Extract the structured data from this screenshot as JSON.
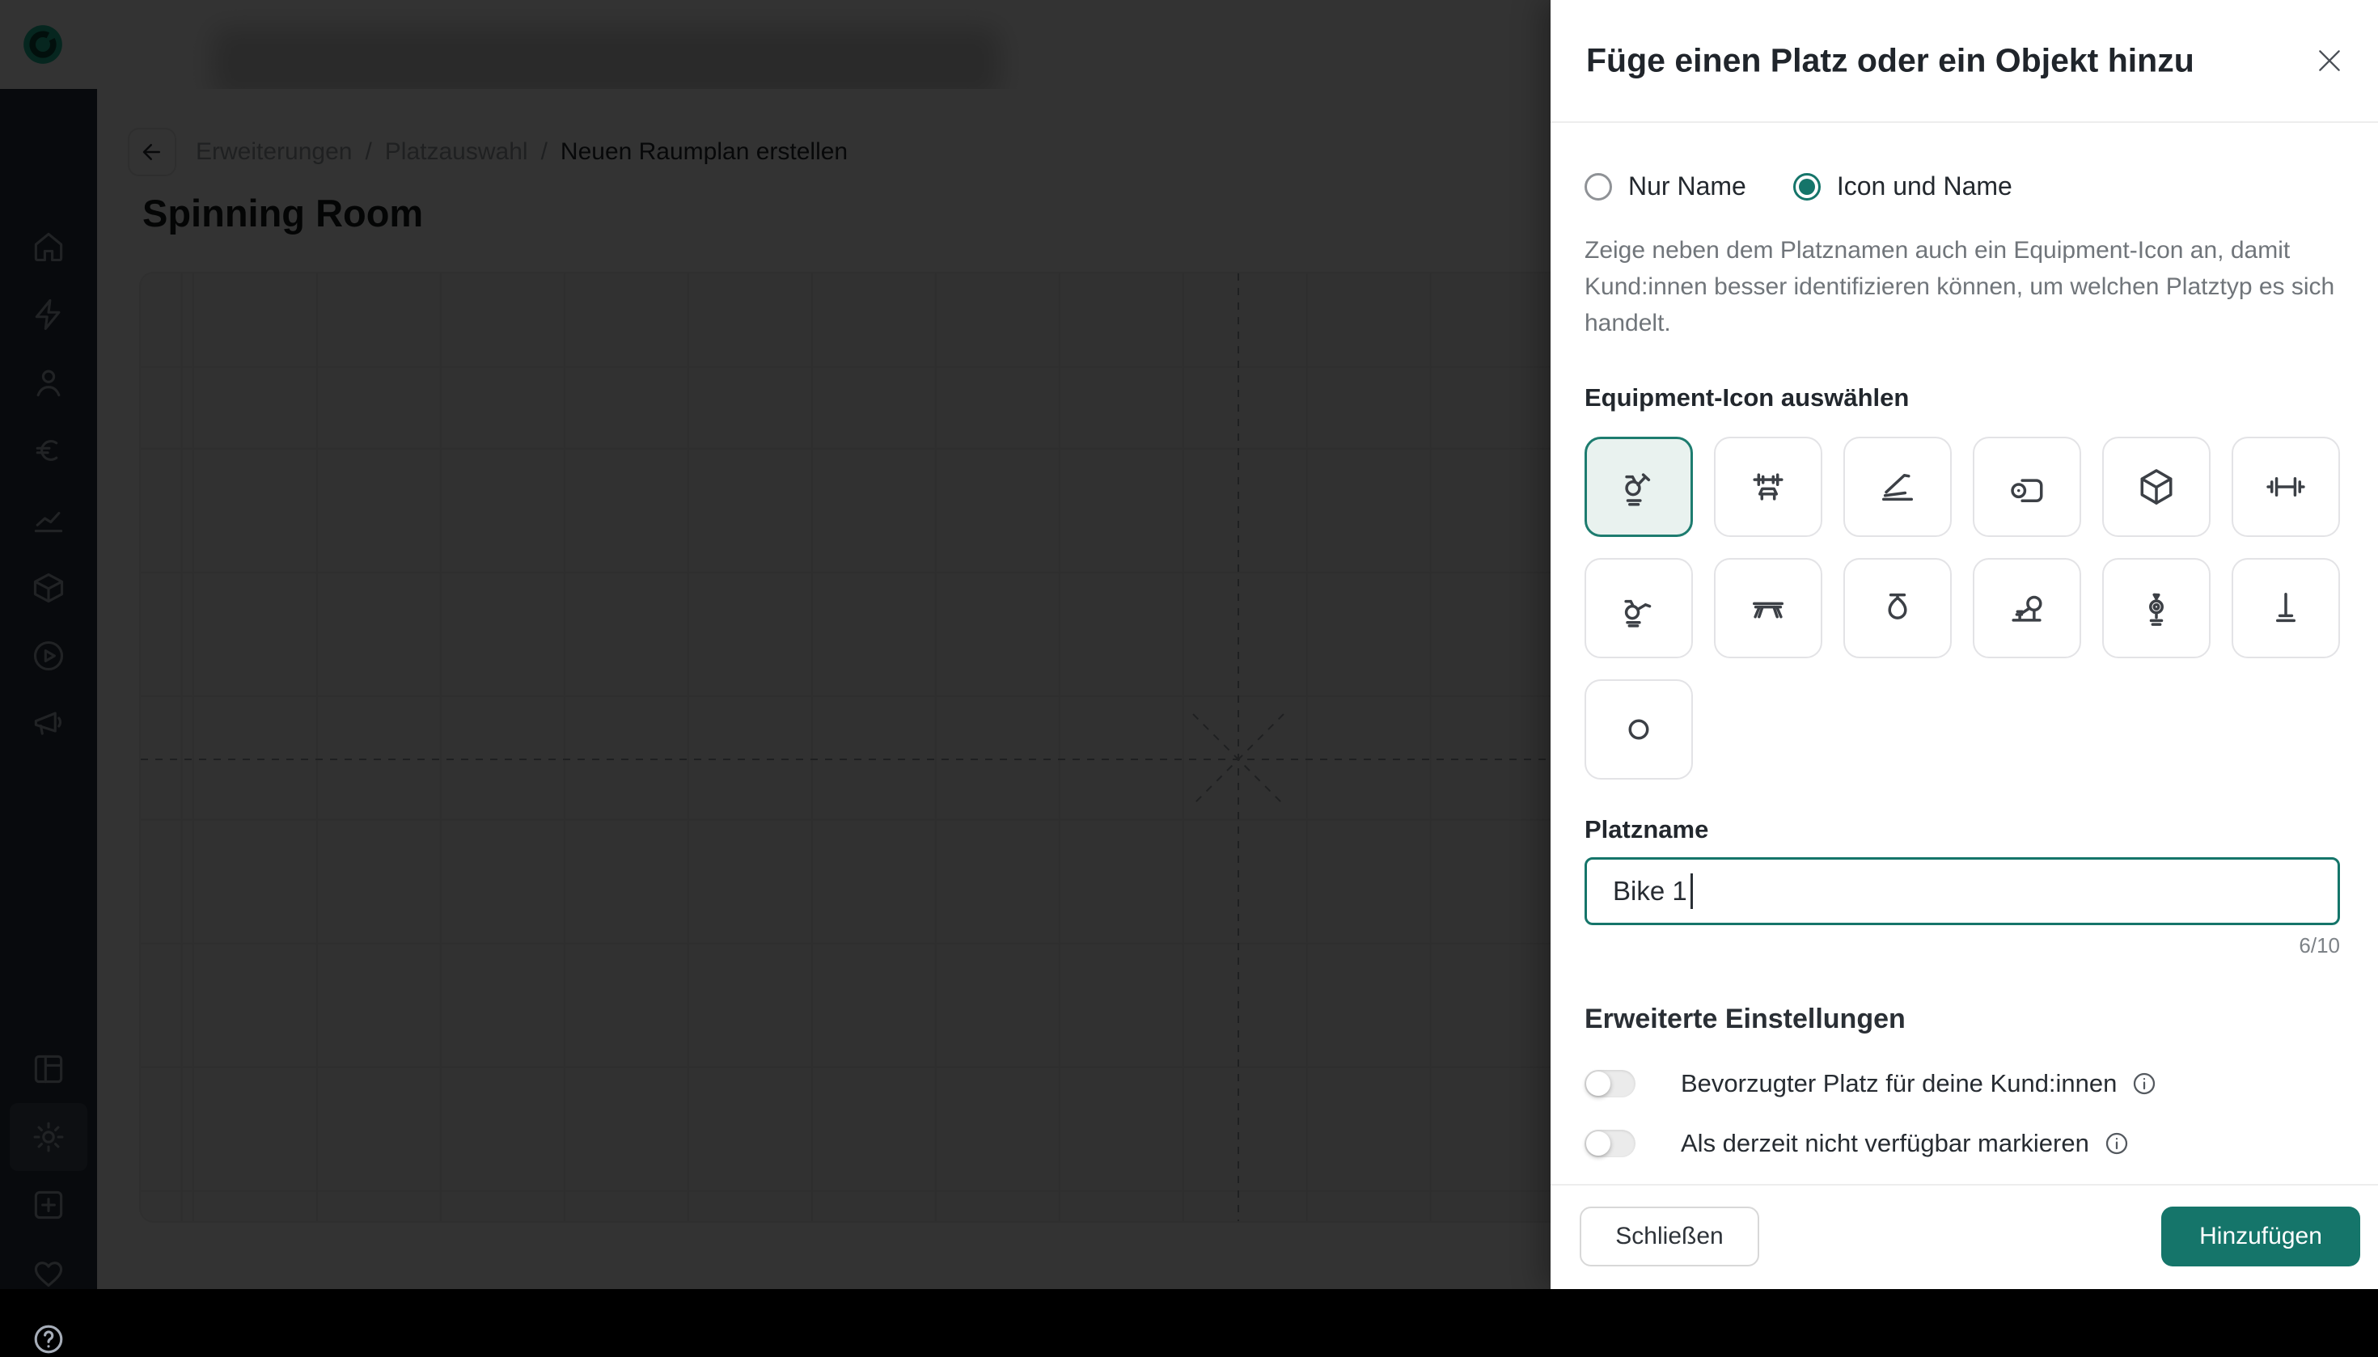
{
  "topbar": {
    "logo": "eversports-logo"
  },
  "sidebar": {
    "icons": [
      "home-icon",
      "lightning-icon",
      "person-icon",
      "euro-icon",
      "chart-icon",
      "package-icon",
      "play-icon",
      "megaphone-icon",
      "layout-icon",
      "gear-icon",
      "plus-square-icon",
      "heart-icon",
      "help-icon"
    ],
    "active": "gear-icon"
  },
  "breadcrumb": {
    "separator": "/",
    "items": [
      "Erweiterungen",
      "Platzauswahl",
      "Neuen Raumplan erstellen"
    ]
  },
  "page": {
    "title": "Spinning Room"
  },
  "panel": {
    "title": "Füge einen Platz oder ein Objekt hinzu",
    "options": {
      "only_name": "Nur Name",
      "icon_and_name": "Icon und Name",
      "selected": "Icon und Name"
    },
    "description": "Zeige neben dem Platznamen auch ein Equipment-Icon an, damit Kund:innen besser identifizieren können, um welchen Platztyp es sich handelt.",
    "equipment_section_title": "Equipment-Icon auswählen",
    "equipment_icons": [
      "spin-bike",
      "bench-press",
      "treadmill",
      "yoga-mat",
      "box",
      "dumbbell",
      "recumbent-bike",
      "bench",
      "punching-bag",
      "rowing-machine",
      "elliptical",
      "pole",
      "spot-circle"
    ],
    "equipment_selected": "spin-bike",
    "name_field": {
      "label": "Platzname",
      "value": "Bike 1",
      "counter": "6/10"
    },
    "advanced_title": "Erweiterte Einstellungen",
    "toggles": [
      {
        "label": "Bevorzugter Platz für deine Kund:innen",
        "state": "off"
      },
      {
        "label": "Als derzeit nicht verfügbar markieren",
        "state": "off"
      }
    ],
    "footer": {
      "close": "Schließen",
      "submit": "Hinzufügen"
    }
  },
  "colors": {
    "accent": "#15756a",
    "selected_tile_border": "#1d7c6f",
    "selected_tile_bg": "#e9f2ef",
    "sidebar_bg": "#2c3440",
    "overlay": "rgba(0,0,0,0.8)"
  }
}
